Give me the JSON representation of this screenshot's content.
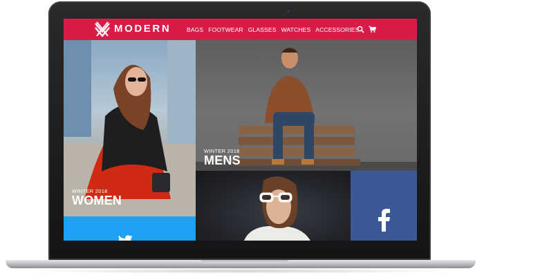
{
  "brand": {
    "name": "MODERN",
    "logo_icon": "crossed-chevrons-logo"
  },
  "nav": {
    "items": [
      "BAGS",
      "FOOTWEAR",
      "GLASSES",
      "WATCHES",
      "ACCESSORIES"
    ],
    "icons": [
      "search-icon",
      "cart-icon"
    ]
  },
  "tiles": {
    "women": {
      "season": "WINTER 2018",
      "title": "WOMEN"
    },
    "mens": {
      "season": "WINTER 2018",
      "title": "MENS"
    },
    "facebook": {
      "icon": "facebook-icon"
    },
    "twitter": {
      "icon": "twitter-icon"
    }
  },
  "colors": {
    "nav_bar": "#d81b47",
    "facebook": "#3b5998",
    "twitter": "#1da1f2"
  }
}
